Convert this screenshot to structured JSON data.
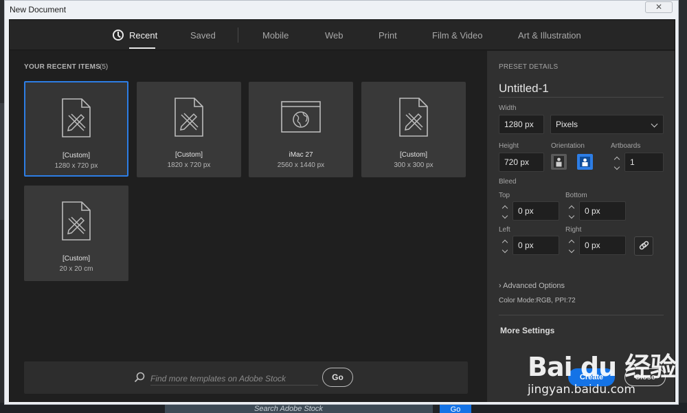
{
  "window": {
    "title": "New Document",
    "close_glyph": "✕"
  },
  "tabs": [
    {
      "label": "Recent",
      "active": true,
      "icon": "clock-icon"
    },
    {
      "label": "Saved"
    },
    {
      "label": "Mobile"
    },
    {
      "label": "Web"
    },
    {
      "label": "Print"
    },
    {
      "label": "Film & Video"
    },
    {
      "label": "Art & Illustration"
    }
  ],
  "recent": {
    "title": "YOUR RECENT ITEMS",
    "count": "(5)",
    "items": [
      {
        "name": "[Custom]",
        "size": "1280 x 720 px",
        "icon": "document-pencil-icon",
        "selected": true
      },
      {
        "name": "[Custom]",
        "size": "1820 x 720 px",
        "icon": "document-pencil-icon"
      },
      {
        "name": "iMac 27",
        "size": "2560 x 1440 px",
        "icon": "web-browser-icon"
      },
      {
        "name": "[Custom]",
        "size": "300 x 300 px",
        "icon": "document-pencil-icon"
      },
      {
        "name": "[Custom]",
        "size": "20 x 20 cm",
        "icon": "document-pencil-icon"
      }
    ]
  },
  "stock": {
    "placeholder": "Find more templates on Adobe Stock",
    "go": "Go"
  },
  "preset": {
    "heading": "PRESET DETAILS",
    "doc_name": "Untitled-1",
    "width_label": "Width",
    "width_value": "1280 px",
    "unit": "Pixels",
    "height_label": "Height",
    "height_value": "720 px",
    "orientation_label": "Orientation",
    "artboards_label": "Artboards",
    "artboards_value": "1",
    "bleed_label": "Bleed",
    "top_label": "Top",
    "top_value": "0 px",
    "bottom_label": "Bottom",
    "bottom_value": "0 px",
    "left_label": "Left",
    "left_value": "0 px",
    "right_label": "Right",
    "right_value": "0 px",
    "advanced": "Advanced Options",
    "color_mode": "Color Mode:RGB, PPI:72",
    "more_settings": "More Settings",
    "create": "Create",
    "close": "Close"
  },
  "background": {
    "search_placeholder": "Search Adobe Stock",
    "go": "Go"
  },
  "watermark": {
    "logo": "Bai du 经验",
    "url": "jingyan.baidu.com"
  },
  "colors": {
    "accent": "#1473e6",
    "selected_border": "#2d7ee6",
    "panel": "#303030",
    "dialog": "#1f1f1f"
  }
}
